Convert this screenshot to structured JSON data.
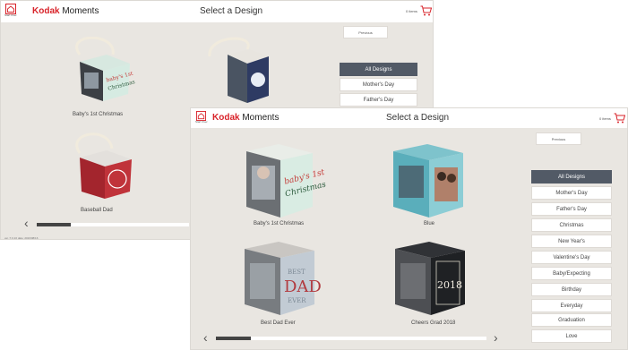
{
  "back_screen": {
    "brand": {
      "name": "Kodak",
      "suffix": " Moments"
    },
    "home_label": "Start Over",
    "title": "Select a Design",
    "cart": {
      "count_label": "0 items"
    },
    "previous_label": "Previous",
    "categories": [
      "All Designs",
      "Mother's Day",
      "Father's Day"
    ],
    "products": [
      {
        "name": "Baby's 1st Christmas"
      },
      {
        "name": ""
      },
      {
        "name": "Baseball Dad"
      }
    ],
    "version": "ver.:7.0.10   date: 2016/08/16"
  },
  "front_screen": {
    "brand": {
      "name": "Kodak",
      "suffix": " Moments"
    },
    "home_label": "Start Over",
    "title": "Select a Design",
    "cart": {
      "count_label": "0 items"
    },
    "previous_label": "Previous",
    "categories": [
      "All Designs",
      "Mother's Day",
      "Father's Day",
      "Christmas",
      "New Year's",
      "Valentine's Day",
      "Baby/Expecting",
      "Birthday",
      "Everyday",
      "Graduation",
      "Love"
    ],
    "selected_category": "All Designs",
    "products": [
      {
        "name": "Baby's 1st Christmas"
      },
      {
        "name": "Blue"
      },
      {
        "name": "Best Dad Ever",
        "text_on_cube": [
          "BEST",
          "DAD",
          "EVER"
        ]
      },
      {
        "name": "Cheers Grad 2018",
        "text_on_cube": [
          "2018"
        ]
      }
    ],
    "scroll": {
      "position_fraction": 0.0,
      "visible_fraction": 0.13
    }
  },
  "colors": {
    "accent": "#d8232a",
    "active_category": "#525a66",
    "background": "#e9e6e1"
  },
  "icons": [
    "home-icon",
    "cart-icon",
    "chevron-left-icon",
    "chevron-right-icon"
  ]
}
